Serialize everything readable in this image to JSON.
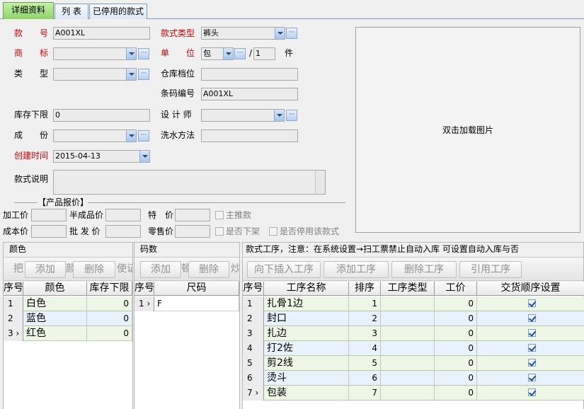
{
  "tabs": [
    {
      "label": "详细资料"
    },
    {
      "label": "列 表"
    },
    {
      "label": "已停用的款式"
    }
  ],
  "form": {
    "style_no_label": "款　　号",
    "style_no_value": "A001XL",
    "style_type_label": "款式类型",
    "style_type_value": "裤头",
    "brand_label": "商　　标",
    "brand_value": "",
    "unit_label": "单　　位",
    "unit_value": "包",
    "unit_ratio_sep": "/",
    "unit_ratio_value": "1",
    "unit_ratio_suffix": "件",
    "category_label": "类　　型",
    "category_value": "",
    "warehouse_label": "仓库档位",
    "warehouse_value": "",
    "barcode_label": "条码编号",
    "barcode_value": "A001XL",
    "stock_min_label": "库存下限",
    "stock_min_value": "0",
    "designer_label": "设 计 师",
    "designer_value": "",
    "composition_label": "成　　份",
    "composition_value": "",
    "wash_label": "洗水方法",
    "wash_value": "",
    "created_label": "创建时间",
    "created_value": "2015-04-13",
    "desc_label": "款式说明",
    "desc_value": "",
    "image_hint": "双击加载图片"
  },
  "pricing": {
    "section_title": "【产品报价】",
    "process_price_label": "加工价",
    "semi_price_label": "半成品价",
    "special_price_label": "特　价",
    "cost_price_label": "成本价",
    "wholesale_label": "批 发 价",
    "retail_label": "零售价",
    "push_label": "主推款",
    "offshelf_label": "是否下架",
    "disabled_label": "是否停用该款式"
  },
  "colors": {
    "title": "颜色",
    "toolbar": {
      "left_frag": "把",
      "add": "添加",
      "mid_frag": "颜",
      "delete": "删除",
      "right_frag": "使证"
    },
    "headers": [
      "序号",
      "颜色",
      "库存下限"
    ],
    "rows": [
      {
        "idx": "1",
        "name": "白色",
        "min": "0"
      },
      {
        "idx": "2",
        "name": "蓝色",
        "min": "0"
      },
      {
        "idx": "3",
        "name": "红色",
        "min": "0"
      }
    ]
  },
  "sizes": {
    "title": "码数",
    "toolbar": {
      "add": "添加",
      "mid_frag": "顿",
      "delete": "删除",
      "right_frag": "炒"
    },
    "headers": [
      "序号",
      "尺码"
    ],
    "rows": [
      {
        "idx": "1",
        "name": "F"
      }
    ]
  },
  "process": {
    "title": "款式工序，注意：在系统设置→扫工票禁止自动入库 可设置自动入库与否",
    "toolbar": {
      "insert": "向下插入工序",
      "add": "添加工序",
      "delete": "删除工序",
      "reference": "引用工序"
    },
    "headers": [
      "序号",
      "工序名称",
      "排序",
      "工序类型",
      "工价",
      "交货顺序设置"
    ],
    "rows": [
      {
        "idx": "1",
        "name": "扎骨1边",
        "order": "1",
        "type": "",
        "price": "0",
        "deliver": true
      },
      {
        "idx": "2",
        "name": "封口",
        "order": "2",
        "type": "",
        "price": "0",
        "deliver": true
      },
      {
        "idx": "3",
        "name": "扎边",
        "order": "3",
        "type": "",
        "price": "0",
        "deliver": true
      },
      {
        "idx": "4",
        "name": "打2佐",
        "order": "4",
        "type": "",
        "price": "0",
        "deliver": true
      },
      {
        "idx": "5",
        "name": "剪2线",
        "order": "5",
        "type": "",
        "price": "0",
        "deliver": true
      },
      {
        "idx": "6",
        "name": "烫斗",
        "order": "6",
        "type": "",
        "price": "0",
        "deliver": true
      },
      {
        "idx": "7",
        "name": "包装",
        "order": "7",
        "type": "",
        "price": "0",
        "deliver": true
      }
    ]
  },
  "colors_theme": {
    "label_red": "#d00000",
    "tab_active": "#8fd36a",
    "row_green": "#eef6e6",
    "row_blue": "#e8f2fb"
  }
}
